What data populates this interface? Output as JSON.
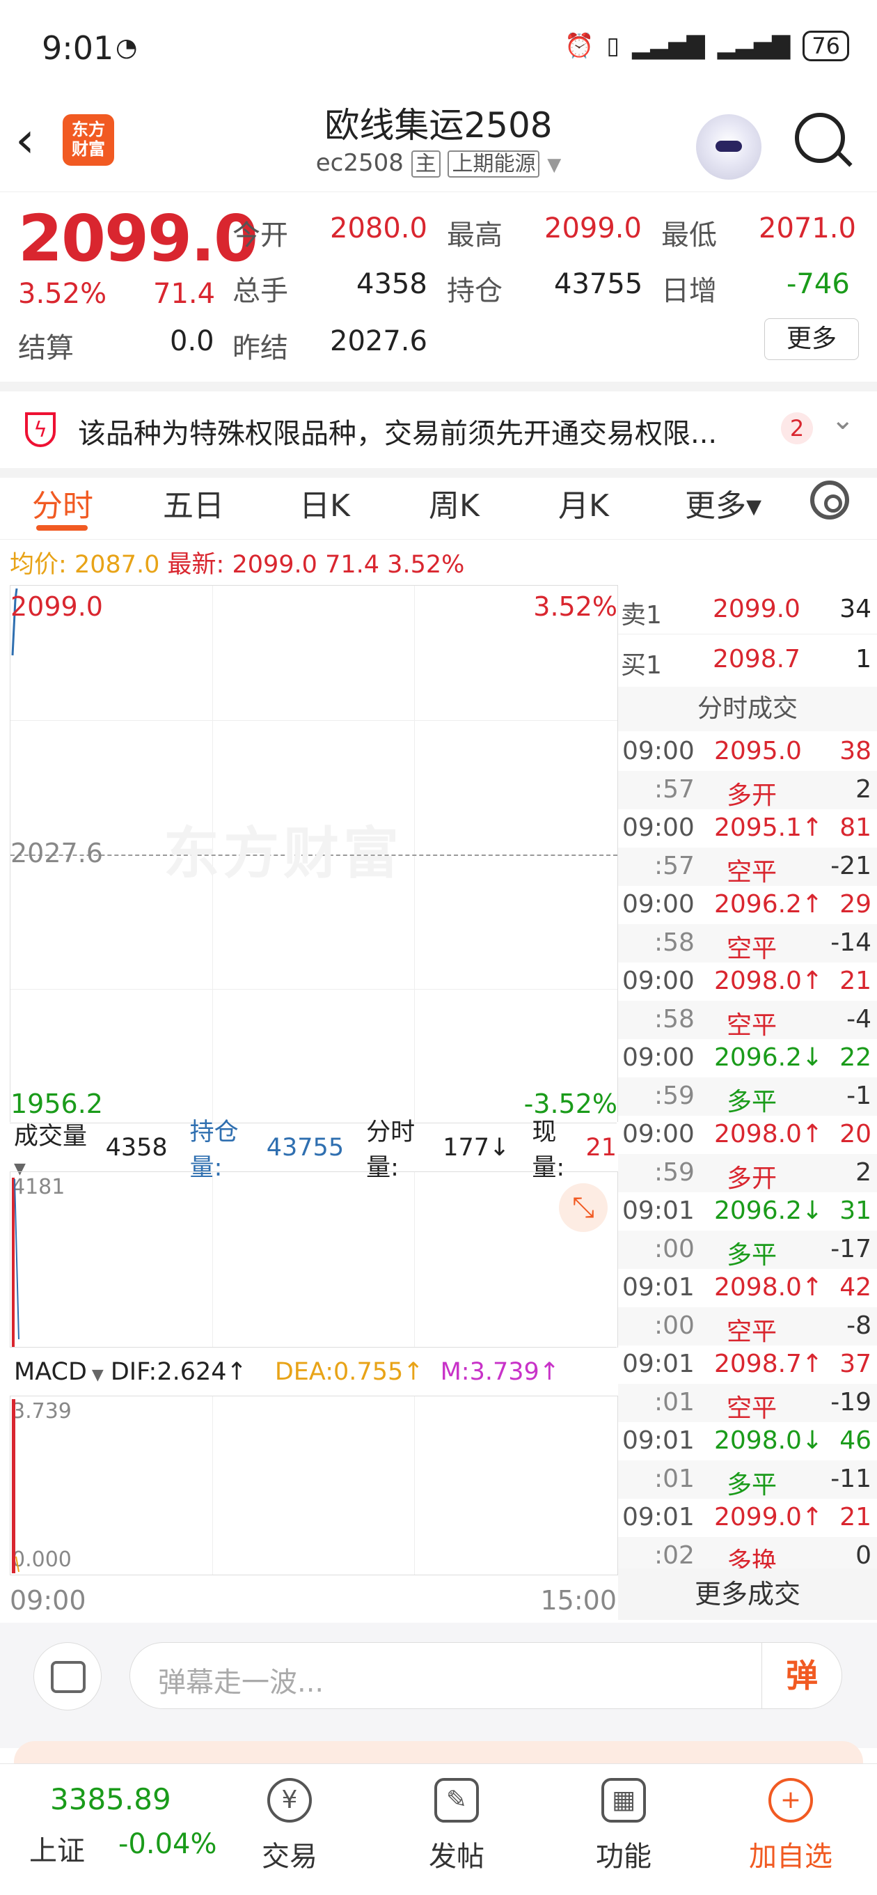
{
  "status_bar": {
    "time": "9:01",
    "battery": "76"
  },
  "header": {
    "title": "欧线集运2508",
    "code": "ec2508",
    "main_tag": "主",
    "exchange_tag": "上期能源",
    "logo_text_1": "东方",
    "logo_text_2": "财富"
  },
  "quote": {
    "price": "2099.0",
    "change_pct": "3.52%",
    "change": "71.4",
    "settle_label": "结算",
    "settle": "0.0",
    "fields": [
      {
        "label": "今开",
        "value": "2080.0"
      },
      {
        "label": "最高",
        "value": "2099.0"
      },
      {
        "label": "最低",
        "value": "2071.0"
      },
      {
        "label": "总手",
        "value": "4358"
      },
      {
        "label": "持仓",
        "value": "43755"
      },
      {
        "label": "日增",
        "value": "-746"
      },
      {
        "label": "昨结",
        "value": "2027.6"
      }
    ],
    "more_label": "更多"
  },
  "notice": {
    "text": "该品种为特殊权限品种，交易前须先开通交易权限...",
    "badge": "2"
  },
  "tabs": [
    "分时",
    "五日",
    "日K",
    "周K",
    "月K",
    "更多▾"
  ],
  "avg_line": {
    "avg_label": "均价:",
    "avg": "2087.0",
    "last_label": "最新:",
    "last": "2099.0",
    "chg": "71.4",
    "pct": "3.52%"
  },
  "chart": {
    "high": "2099.0",
    "high_pct": "3.52%",
    "mid": "2027.6",
    "low": "1956.2",
    "low_pct": "-3.52%",
    "watermark": "东方财富"
  },
  "volume": {
    "label": "成交量",
    "total": "4358",
    "oi_label": "持仓量:",
    "oi": "43755",
    "tick_label": "分时量:",
    "tick": "177↓",
    "now_label": "现量:",
    "now": "21",
    "max": "4181"
  },
  "macd": {
    "label": "MACD",
    "dif": "DIF:2.624↑",
    "dea": "DEA:0.755↑",
    "m": "M:3.739↑",
    "max": "3.739",
    "min": "0.000"
  },
  "time_axis": {
    "start": "09:00",
    "end": "15:00"
  },
  "order_book": {
    "sell_label": "卖1",
    "sell_price": "2099.0",
    "sell_vol": "34",
    "buy_label": "买1",
    "buy_price": "2098.7",
    "buy_vol": "1",
    "trades_title": "分时成交",
    "more_trades": "更多成交"
  },
  "trades": [
    {
      "time": "09:00",
      "price": "2095.0",
      "vol": "38",
      "sub_time": ":57",
      "kind": "多开",
      "delta": "2",
      "dir": ""
    },
    {
      "time": "09:00",
      "price": "2095.1↑",
      "vol": "81",
      "sub_time": ":57",
      "kind": "空平",
      "delta": "-21",
      "dir": "up"
    },
    {
      "time": "09:00",
      "price": "2096.2↑",
      "vol": "29",
      "sub_time": ":58",
      "kind": "空平",
      "delta": "-14",
      "dir": "up"
    },
    {
      "time": "09:00",
      "price": "2098.0↑",
      "vol": "21",
      "sub_time": ":58",
      "kind": "空平",
      "delta": "-4",
      "dir": "up"
    },
    {
      "time": "09:00",
      "price": "2096.2↓",
      "vol": "22",
      "sub_time": ":59",
      "kind": "多平",
      "delta": "-1",
      "dir": "down"
    },
    {
      "time": "09:00",
      "price": "2098.0↑",
      "vol": "20",
      "sub_time": ":59",
      "kind": "多开",
      "delta": "2",
      "dir": "up"
    },
    {
      "time": "09:01",
      "price": "2096.2↓",
      "vol": "31",
      "sub_time": ":00",
      "kind": "多平",
      "delta": "-17",
      "dir": "down"
    },
    {
      "time": "09:01",
      "price": "2098.0↑",
      "vol": "42",
      "sub_time": ":00",
      "kind": "空平",
      "delta": "-8",
      "dir": "up"
    },
    {
      "time": "09:01",
      "price": "2098.7↑",
      "vol": "37",
      "sub_time": ":01",
      "kind": "空平",
      "delta": "-19",
      "dir": "up"
    },
    {
      "time": "09:01",
      "price": "2098.0↓",
      "vol": "46",
      "sub_time": ":01",
      "kind": "多平",
      "delta": "-11",
      "dir": "down"
    },
    {
      "time": "09:01",
      "price": "2099.0↑",
      "vol": "21",
      "sub_time": ":02",
      "kind": "多换",
      "delta": "0",
      "dir": "up"
    }
  ],
  "danmu": {
    "placeholder": "弹幕走一波...",
    "send": "弹"
  },
  "nav": {
    "index_value": "3385.89",
    "index_name": "上证",
    "index_change": "-0.04%",
    "items": [
      {
        "label": "交易",
        "icon": "¥"
      },
      {
        "label": "发帖",
        "icon": "✎"
      },
      {
        "label": "功能",
        "icon": "▦"
      },
      {
        "label": "加自选",
        "icon": "+"
      }
    ]
  },
  "colors": {
    "up": "#d9262f",
    "down": "#1a9b1a",
    "accent": "#f15a22",
    "avg": "#e8a317",
    "dea": "#e8a317",
    "m": "#c832c8",
    "oi": "#2f6fb0"
  }
}
